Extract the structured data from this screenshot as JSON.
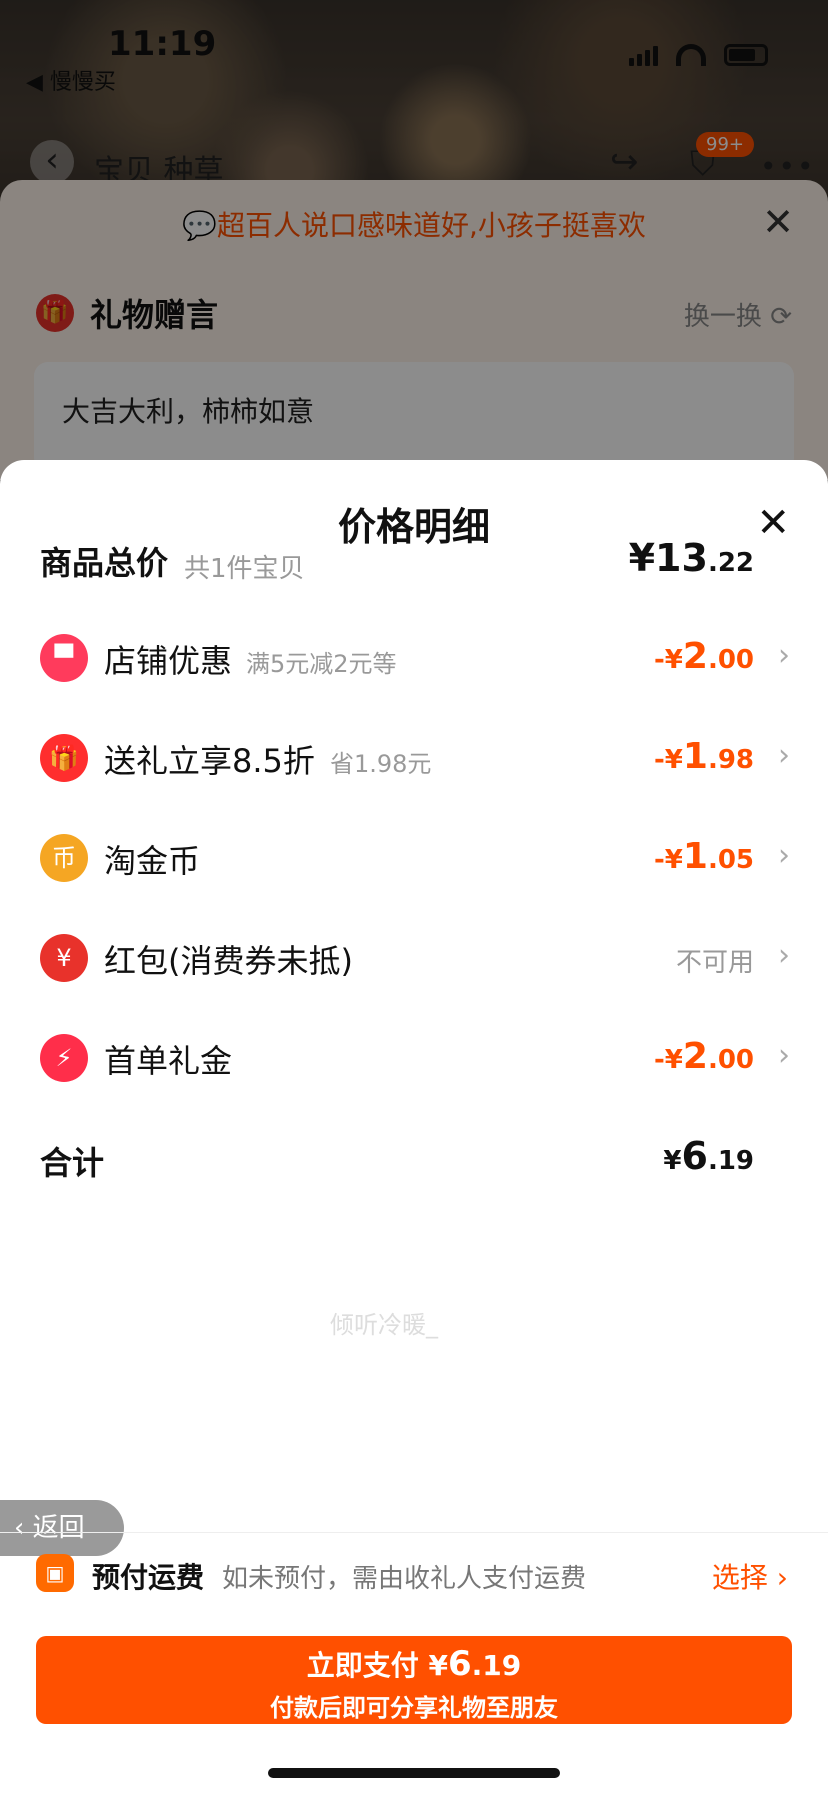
{
  "status": {
    "time": "11:19",
    "back_app": "◀ 慢慢买"
  },
  "nav": {
    "title": "宝贝  种草",
    "cart_badge": "99+"
  },
  "gift_sheet": {
    "tip": "超百人说口感味道好,小孩子挺喜欢",
    "title": "礼物赠言",
    "swap": "换一换",
    "message": "大吉大利，柿柿如意"
  },
  "modal": {
    "title": "价格明细",
    "goods_total": {
      "label": "商品总价",
      "sub": "共1件宝贝",
      "currency": "¥",
      "int": "13",
      "dec": ".22"
    },
    "rows": [
      {
        "label": "店铺优惠",
        "sub": "满5元减2元等",
        "prefix": "-¥",
        "int": "2",
        "dec": ".00",
        "icon": "shop-icon",
        "icon_color": "#ff3b5c"
      },
      {
        "label": "送礼立享8.5折",
        "sub": "省1.98元",
        "prefix": "-¥",
        "int": "1",
        "dec": ".98",
        "icon": "gift-icon",
        "icon_color": "#ff2e2e"
      },
      {
        "label": "淘金币",
        "sub": "",
        "prefix": "-¥",
        "int": "1",
        "dec": ".05",
        "icon": "coin-icon",
        "icon_color": "#f5a623"
      },
      {
        "label": "红包(消费券未抵)",
        "sub": "",
        "status": "不可用",
        "icon": "red-envelope-icon",
        "icon_color": "#e8322b"
      },
      {
        "label": "首单礼金",
        "sub": "",
        "prefix": "-¥",
        "int": "2",
        "dec": ".00",
        "icon": "lightning-icon",
        "icon_color": "#ff2e4a"
      }
    ],
    "total": {
      "label": "合计",
      "currency": "¥",
      "int": "6",
      "dec": ".19"
    },
    "watermark": "倾听冷暖_"
  },
  "back_pill": "返回",
  "shipping": {
    "label": "预付运费",
    "note": "如未预付，需由收礼人支付运费",
    "select": "选择"
  },
  "pay": {
    "label": "立即支付",
    "currency": "¥",
    "int": "6",
    "dec": ".19",
    "note": "付款后即可分享礼物至朋友"
  },
  "colors": {
    "accent": "#ff5000"
  }
}
